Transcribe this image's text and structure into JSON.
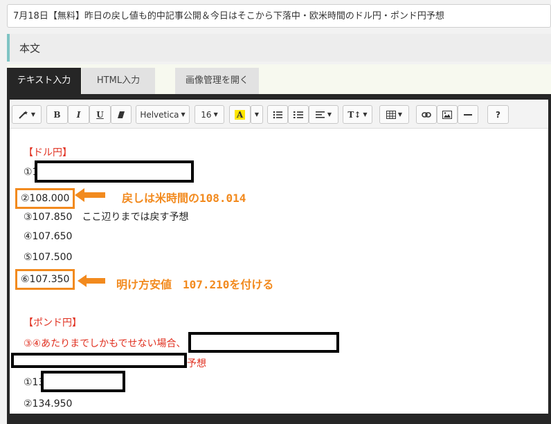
{
  "title_field": {
    "value": "7月18日【無料】昨日の戻し値も的中記事公開＆今日はそこから下落中・欧米時間のドル円・ポンド円予想"
  },
  "section": {
    "label": "本文"
  },
  "tabs": [
    {
      "label": "テキスト入力",
      "active": true
    },
    {
      "label": "HTML入力",
      "active": false
    },
    {
      "label": "画像管理を開く",
      "active": false
    }
  ],
  "toolbar": {
    "bold": "B",
    "italic": "I",
    "underline": "U",
    "font_family": "Helvetica",
    "font_size": "16",
    "color_letter": "A",
    "help": "?",
    "line_height": "T↕"
  },
  "body": {
    "usdjpy_heading": "【ドル円】",
    "usdjpy_lines": [
      "①10",
      "②108.000",
      "③107.850　ここ辺りまでは戻す予想",
      "④107.650",
      "⑤107.500",
      "⑥107.350"
    ],
    "annotation_1": "戻しは米時間の108.014",
    "annotation_2": "明け方安値　107.210を付ける",
    "gbpjpy_heading": "【ポンド円】",
    "gbpjpy_note": "③④あたりまでしかもでせない場合、",
    "gbpjpy_note_end": "予想",
    "gbpjpy_lines": [
      "①135",
      "②134.950"
    ]
  },
  "colors": {
    "accent_red": "#e03020",
    "annotation_orange": "#f28a1e",
    "editor_dark": "#262626",
    "section_bar": "#7fc4c4"
  }
}
